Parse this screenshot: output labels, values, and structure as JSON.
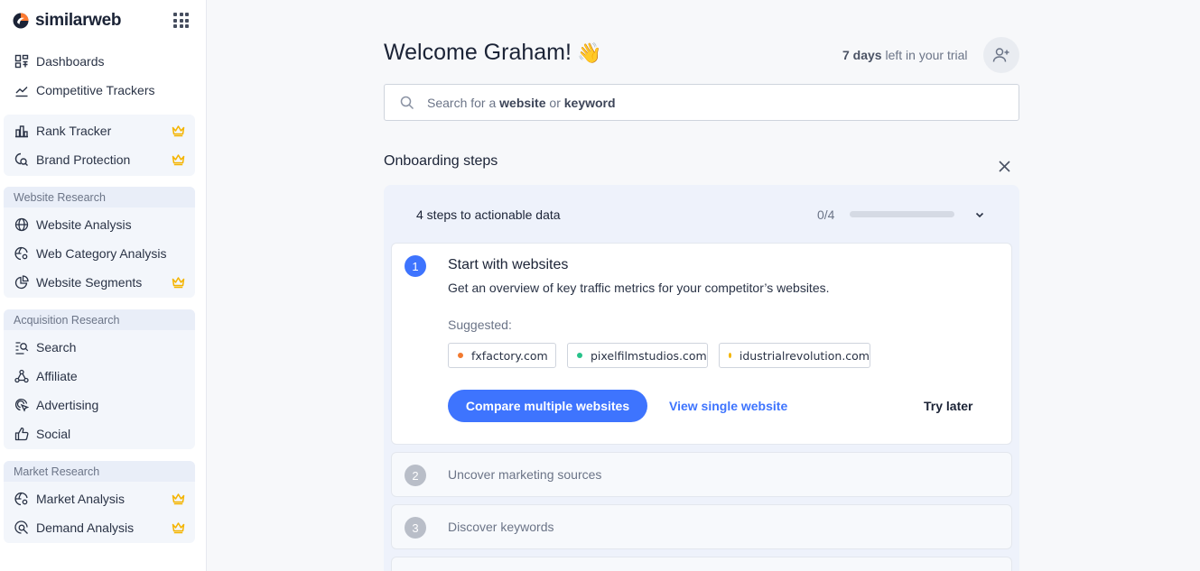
{
  "brand": {
    "name": "similarweb",
    "accent": "#3e74fe"
  },
  "sidebar": {
    "top_items": [
      {
        "label": "Dashboards",
        "icon": "dashboard-icon"
      },
      {
        "label": "Competitive Trackers",
        "icon": "trend-line-icon"
      }
    ],
    "premium_items": [
      {
        "label": "Rank Tracker",
        "icon": "bar-chart-icon",
        "premium": true
      },
      {
        "label": "Brand Protection",
        "icon": "search-shield-icon",
        "premium": true
      }
    ],
    "groups": [
      {
        "title": "Website Research",
        "items": [
          {
            "label": "Website Analysis",
            "icon": "globe-icon",
            "premium": false
          },
          {
            "label": "Web Category Analysis",
            "icon": "globe-gear-icon",
            "premium": false
          },
          {
            "label": "Website Segments",
            "icon": "pie-icon",
            "premium": true
          }
        ]
      },
      {
        "title": "Acquisition Research",
        "items": [
          {
            "label": "Search",
            "icon": "search-list-icon",
            "premium": false
          },
          {
            "label": "Affiliate",
            "icon": "network-icon",
            "premium": false
          },
          {
            "label": "Advertising",
            "icon": "cursor-target-icon",
            "premium": false
          },
          {
            "label": "Social",
            "icon": "thumbs-up-icon",
            "premium": false
          }
        ]
      },
      {
        "title": "Market Research",
        "items": [
          {
            "label": "Market Analysis",
            "icon": "globe-gear-icon",
            "premium": true
          },
          {
            "label": "Demand Analysis",
            "icon": "search-circle-icon",
            "premium": true
          }
        ]
      }
    ]
  },
  "header": {
    "welcome": "Welcome Graham!",
    "wave_emoji": "👋",
    "trial_days": "7 days",
    "trial_suffix": "left in your trial"
  },
  "search": {
    "placeholder_prefix": "Search for a",
    "placeholder_word1": "website",
    "placeholder_mid": "or",
    "placeholder_word2": "keyword",
    "value": ""
  },
  "onboarding": {
    "title": "Onboarding steps",
    "panel_title": "4 steps to actionable data",
    "progress_label": "0/4",
    "progress_fraction": 0,
    "steps": [
      {
        "number": "1",
        "title": "Start with websites",
        "description": "Get an overview of key traffic metrics for your competitor’s websites.",
        "suggested_label": "Suggested:",
        "suggestions": [
          {
            "label": "fxfactory.com",
            "color": "#f27a30"
          },
          {
            "label": "pixelfilmstudios.com",
            "color": "#27c28a"
          },
          {
            "label": "idustrialrevolution.com",
            "color": "#f4b400"
          }
        ],
        "primary_action": "Compare multiple websites",
        "secondary_action": "View single website",
        "tertiary_action": "Try later"
      },
      {
        "number": "2",
        "title": "Uncover marketing sources"
      },
      {
        "number": "3",
        "title": "Discover keywords"
      }
    ]
  }
}
